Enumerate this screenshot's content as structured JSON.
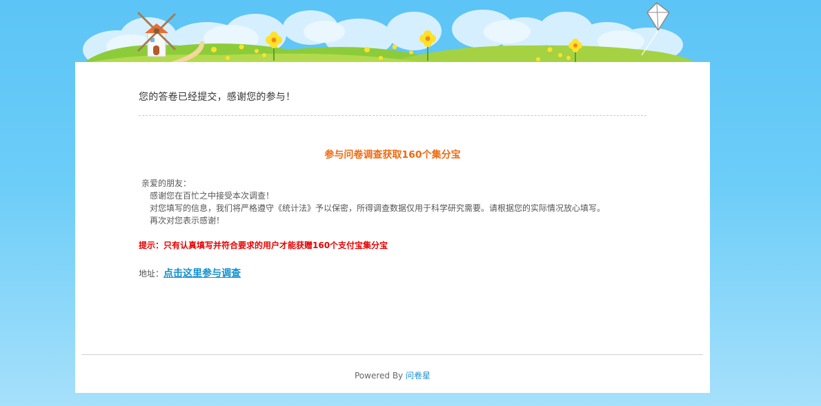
{
  "colors": {
    "background_top": "#5cc4f6",
    "background_bottom": "#a6e0fb",
    "card": "#ffffff",
    "promo_title": "#ef6a10",
    "hint": "#e60000",
    "link": "#0f8fd0"
  },
  "banner": {
    "icons": [
      "windmill-icon",
      "kite-icon",
      "flower-icon",
      "cloud-icon",
      "grass-hill-icon"
    ]
  },
  "main": {
    "thanks_message": "您的答卷已经提交，感谢您的参与！",
    "promo_title": "参与问卷调查获取160个集分宝",
    "letter": {
      "greeting": "亲爱的朋友：",
      "lines": [
        "感谢您在百忙之中接受本次调查！",
        "对您填写的信息，我们将严格遵守《统计法》予以保密，所得调查数据仅用于科学研究需要。请根据您的实际情况放心填写。",
        "再次对您表示感谢！"
      ]
    },
    "hint": "提示：只有认真填写并符合要求的用户才能获赠160个支付宝集分宝",
    "address": {
      "label": "地址：",
      "link_text": "点击这里参与调查"
    }
  },
  "footer": {
    "powered_by": "Powered By",
    "brand": "问卷星"
  }
}
